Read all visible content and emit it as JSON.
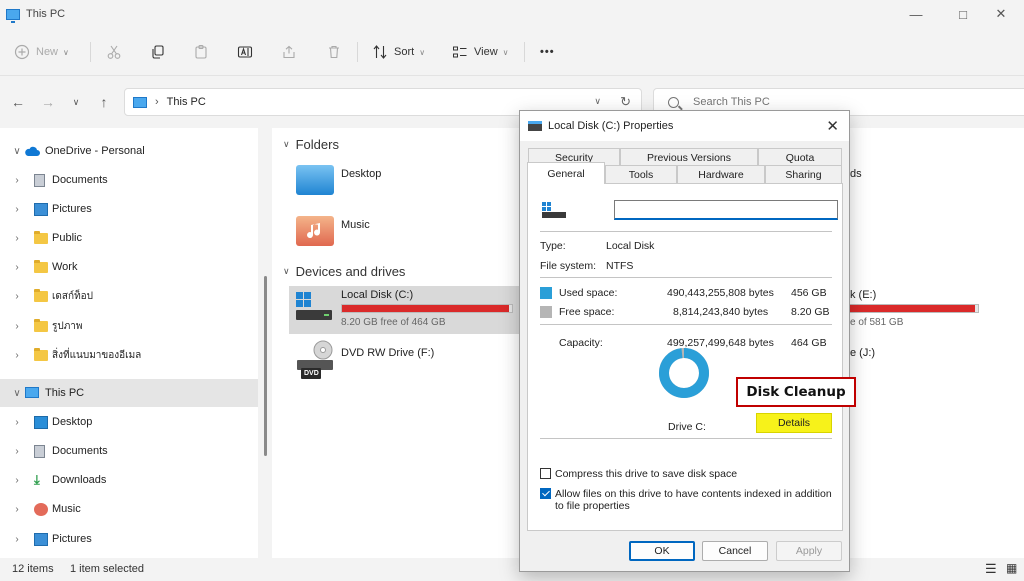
{
  "window": {
    "title": "This PC"
  },
  "toolbar": {
    "new_label": "New",
    "sort_label": "Sort",
    "view_label": "View",
    "more_label": "•••"
  },
  "address": {
    "path": "This PC",
    "search_placeholder": "Search This PC"
  },
  "sidebar": {
    "items": [
      {
        "label": "OneDrive - Personal"
      },
      {
        "label": "Documents"
      },
      {
        "label": "Pictures"
      },
      {
        "label": "Public"
      },
      {
        "label": "Work"
      },
      {
        "label": "เดสก์ท็อป"
      },
      {
        "label": "รูปภาพ"
      },
      {
        "label": "สิ่งที่แนบมาของอีเมล"
      },
      {
        "label": "This PC"
      },
      {
        "label": "Desktop"
      },
      {
        "label": "Documents"
      },
      {
        "label": "Downloads"
      },
      {
        "label": "Music"
      },
      {
        "label": "Pictures"
      }
    ]
  },
  "main": {
    "folders_heading": "Folders",
    "folders": [
      {
        "name": "Desktop"
      },
      {
        "name": "Music"
      }
    ],
    "drives_heading": "Devices and drives",
    "drives": [
      {
        "name": "Local Disk (C:)",
        "free": "8.20 GB free of 464 GB",
        "used_fraction": 0.98
      },
      {
        "name": "DVD RW Drive (F:)",
        "badge": "DVD"
      }
    ],
    "peek": {
      "ds": "ds",
      "drive_e_name": "k (E:)",
      "drive_e_free": "e of 581 GB",
      "drive_e_used_fraction": 0.98,
      "drive_j_name": "e (J:)"
    }
  },
  "status": {
    "items_count": "12 items",
    "selected": "1 item selected"
  },
  "dialog": {
    "title": "Local Disk (C:) Properties",
    "tabs_top": [
      "Security",
      "Previous Versions",
      "Quota"
    ],
    "tabs_bottom": [
      "General",
      "Tools",
      "Hardware",
      "Sharing"
    ],
    "type_label": "Type:",
    "type_value": "Local Disk",
    "fs_label": "File system:",
    "fs_value": "NTFS",
    "used_label": "Used space:",
    "used_bytes": "490,443,255,808 bytes",
    "used_gb": "456 GB",
    "free_label": "Free space:",
    "free_bytes": "8,814,243,840 bytes",
    "free_gb": "8.20 GB",
    "capacity_label": "Capacity:",
    "capacity_bytes": "499,257,499,648 bytes",
    "capacity_gb": "464 GB",
    "drive_label": "Drive C:",
    "cleanup_label": "Disk Cleanup",
    "details_label": "Details",
    "compress_label": "Compress this drive to save disk space",
    "compress_checked": false,
    "index_label": "Allow files on this drive to have contents indexed in addition to file properties",
    "index_checked": true,
    "ok_label": "OK",
    "cancel_label": "Cancel",
    "apply_label": "Apply",
    "used_color": "#2a9fd8",
    "free_color": "#b5b5b5",
    "used_fraction": 0.982
  }
}
